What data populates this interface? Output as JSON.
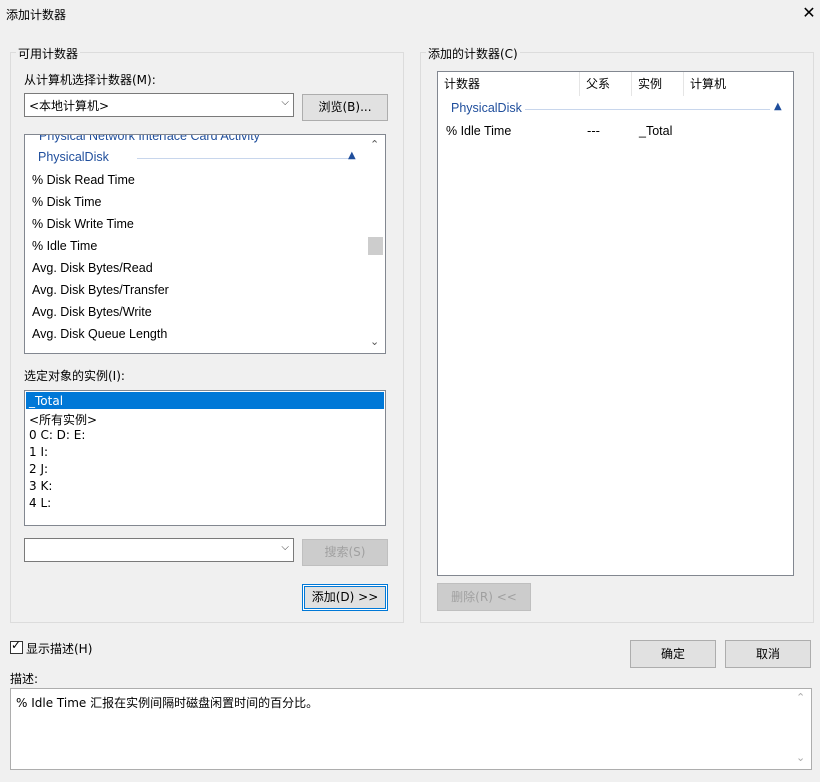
{
  "window": {
    "title": "添加计数器"
  },
  "available": {
    "group_label": "可用计数器",
    "machine_label": "从计算机选择计数器(M):",
    "machine_value": "<本地计算机>",
    "browse_label": "浏览(B)...",
    "partial_top": "Physical Network Interface Card Activity",
    "category": "PhysicalDisk",
    "counters": [
      "% Disk Read Time",
      "% Disk Time",
      "% Disk Write Time",
      "% Idle Time",
      "Avg. Disk Bytes/Read",
      "Avg. Disk Bytes/Transfer",
      "Avg. Disk Bytes/Write",
      "Avg. Disk Queue Length"
    ],
    "instances_label": "选定对象的实例(I):",
    "instances": [
      "_Total",
      "<所有实例>",
      "0 C: D: E:",
      "1 I:",
      "2 J:",
      "3 K:",
      "4 L:"
    ],
    "selected_instance": "_Total",
    "search_value": "",
    "search_label": "搜索(S)",
    "add_label": "添加(D) >>"
  },
  "added": {
    "group_label": "添加的计数器(C)",
    "columns": [
      "计数器",
      "父系",
      "实例",
      "计算机"
    ],
    "category": "PhysicalDisk",
    "rows": [
      {
        "counter": "% Idle Time",
        "parent": "---",
        "instance": "_Total",
        "computer": ""
      }
    ],
    "remove_label": "删除(R) <<"
  },
  "show_description": {
    "label": "显示描述(H)",
    "checked": true
  },
  "ok_label": "确定",
  "cancel_label": "取消",
  "description": {
    "label": "描述:",
    "text": "% Idle Time 汇报在实例间隔时磁盘闲置时间的百分比。"
  }
}
